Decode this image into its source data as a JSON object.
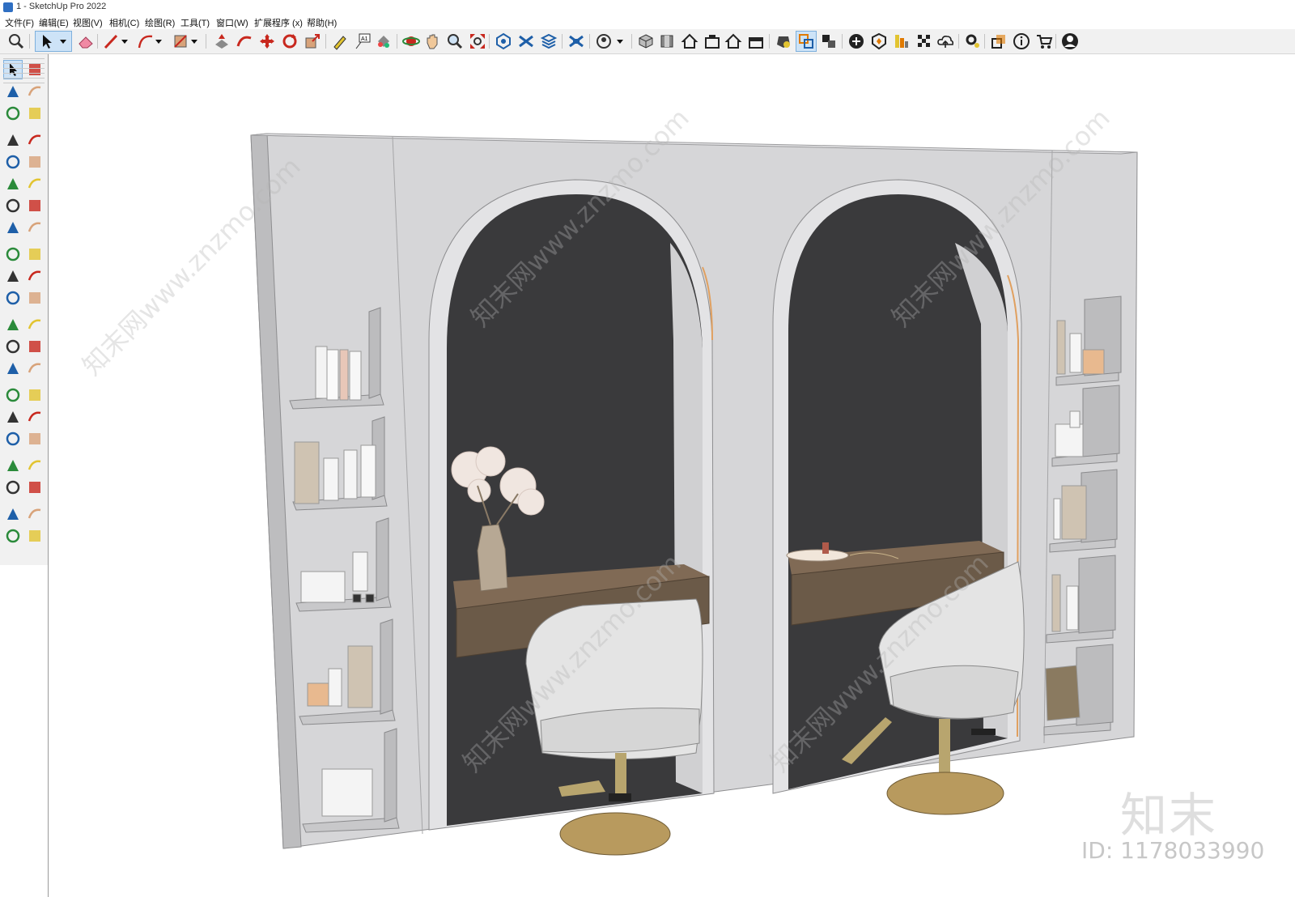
{
  "window": {
    "title": "1 - SketchUp Pro 2022"
  },
  "menu": [
    "文件(F)",
    "编辑(E)",
    "视图(V)",
    "相机(C)",
    "绘图(R)",
    "工具(T)",
    "窗口(W)",
    "扩展程序 (x)",
    "帮助(H)"
  ],
  "watermark": {
    "brand": "知末",
    "id": "ID: 1178033990",
    "diagonal": "知末网www.znzmo.com"
  },
  "colors": {
    "accent": "#2f6fc2",
    "wall": "#d4d4d6",
    "alcove_back": "#3a3a3c",
    "wood": "#6b5a48",
    "gold": "#b89a5e"
  },
  "toolbar_icons": [
    "zoom-icon",
    "select-icon",
    "eraser-icon",
    "pencil-icon",
    "arc-icon",
    "rectangle-icon",
    "push-pull-icon",
    "follow-me-icon",
    "move-icon",
    "rotate-icon",
    "scale-icon",
    "tape-measure-icon",
    "text-icon",
    "paint-bucket-icon",
    "orbit-icon",
    "pan-icon",
    "zoom-icon",
    "zoom-extents-icon",
    "3d-warehouse-icon",
    "extension-warehouse-icon",
    "layout-icon",
    "style-builder-icon",
    "user-icon",
    "iso-view-icon",
    "top-view-icon",
    "front-view-icon",
    "right-view-icon",
    "back-view-icon",
    "left-view-icon",
    "solid-tools-icon",
    "section-plane-icon",
    "section-display-icon",
    "add-location-icon",
    "terrain-icon",
    "photo-texture-icon",
    "trimble-icon",
    "cloud-icon",
    "settings-icon",
    "outliner-icon",
    "info-icon",
    "cart-icon",
    "account-icon"
  ],
  "palette_icons": [
    "select-icon",
    "lasso-icon",
    "paint-bucket-icon",
    "eraser-icon",
    "component-icon",
    "tag-icon",
    "pencil-icon",
    "freehand-icon",
    "rectangle-icon",
    "rotated-rectangle-icon",
    "circle-icon",
    "polygon-icon",
    "arc-icon",
    "two-point-arc-icon",
    "three-point-arc-icon",
    "pie-icon",
    "move-icon",
    "push-pull-icon",
    "rotate-icon",
    "follow-me-icon",
    "scale-icon",
    "offset-icon",
    "tape-measure-icon",
    "dimension-icon",
    "protractor-icon",
    "text-icon",
    "axes-icon",
    "3d-text-icon",
    "orbit-icon",
    "pan-icon",
    "zoom-icon",
    "zoom-window-icon",
    "zoom-extents-icon",
    "previous-view-icon",
    "position-camera-icon",
    "look-around-icon",
    "walk-icon",
    "section-plane-icon",
    "warehouse-icon",
    "extension-warehouse-icon",
    "layout-icon",
    "style-builder-icon"
  ]
}
